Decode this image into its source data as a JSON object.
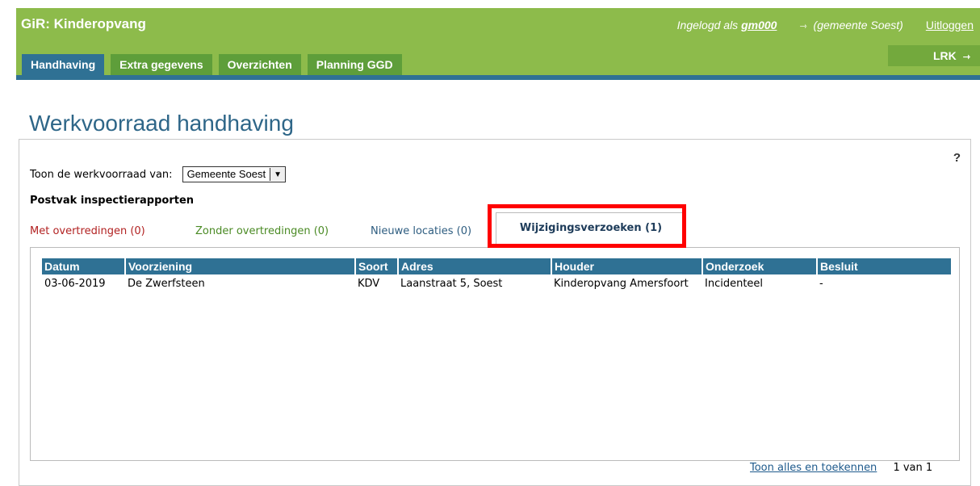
{
  "header": {
    "app_title": "GiR: Kinderopvang",
    "logged_in_prefix": "Ingelogd als",
    "username": "gm000",
    "arrow_glyph": "⇾",
    "municipality": "(gemeente Soest)",
    "logout": "Uitloggen",
    "lrk_label": "LRK"
  },
  "nav": {
    "tabs": [
      {
        "label": "Handhaving"
      },
      {
        "label": "Extra gegevens"
      },
      {
        "label": "Overzichten"
      },
      {
        "label": "Planning GGD"
      }
    ]
  },
  "page": {
    "title": "Werkvoorraad handhaving",
    "help": "?",
    "filter_label": "Toon de werkvoorraad van:",
    "filter_value": "Gemeente Soest",
    "postvak": "Postvak inspectierapporten"
  },
  "subtabs": {
    "met": "Met overtredingen (0)",
    "zonder": "Zonder overtredingen (0)",
    "nieuw": "Nieuwe locaties (0)",
    "wijziging": "Wijzigingsverzoeken (1)"
  },
  "table": {
    "headers": [
      "Datum",
      "Voorziening",
      "Soort",
      "Adres",
      "Houder",
      "Onderzoek",
      "Besluit"
    ],
    "rows": [
      [
        "03-06-2019",
        "De Zwerfsteen",
        "KDV",
        "Laanstraat 5, Soest",
        "Kinderopvang Amersfoort",
        "Incidenteel",
        "-"
      ]
    ]
  },
  "footer": {
    "link": "Toon alles en toekennen",
    "count": "1 van 1"
  },
  "colors": {
    "header_green": "#8dbb4b",
    "tab_green": "#5e9e3a",
    "blue": "#2f7194",
    "highlight": "#ff0000"
  }
}
